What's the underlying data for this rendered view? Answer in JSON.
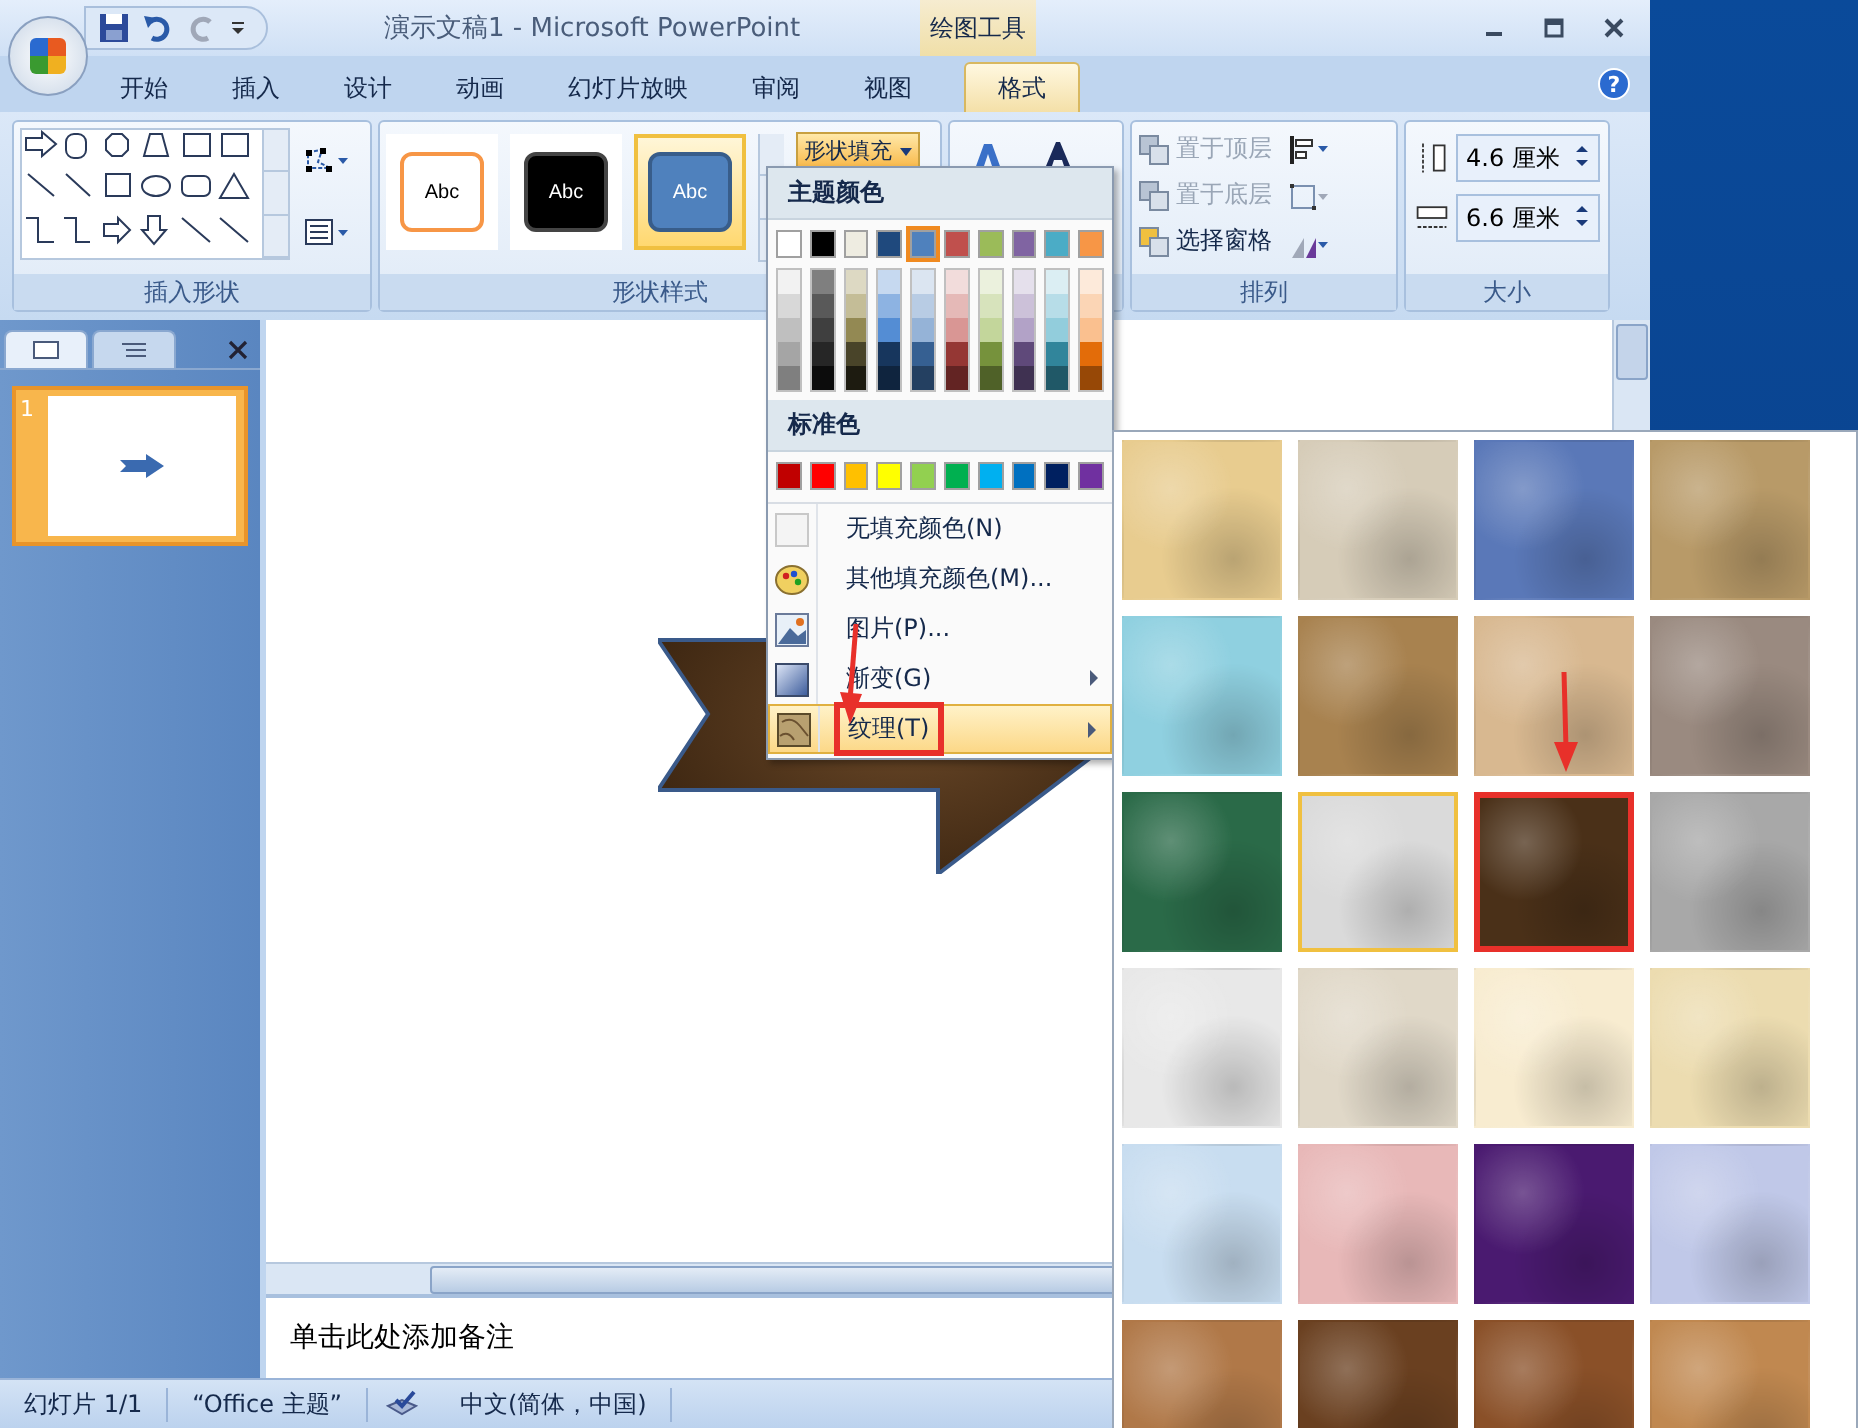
{
  "window": {
    "title": "演示文稿1 - Microsoft PowerPoint",
    "context_group": "绘图工具",
    "help_label": "?"
  },
  "tabs": [
    {
      "label": "开始",
      "selected": false
    },
    {
      "label": "插入",
      "selected": false
    },
    {
      "label": "设计",
      "selected": false
    },
    {
      "label": "动画",
      "selected": false
    },
    {
      "label": "幻灯片放映",
      "selected": false
    },
    {
      "label": "审阅",
      "selected": false
    },
    {
      "label": "视图",
      "selected": false
    },
    {
      "label": "格式",
      "selected": true
    }
  ],
  "insert_shapes": {
    "label": "插入形状"
  },
  "shape_styles": {
    "label": "形状样式",
    "styles": [
      {
        "text": "Abc",
        "kind": "outline",
        "selected": false
      },
      {
        "text": "Abc",
        "kind": "dark",
        "selected": false
      },
      {
        "text": "Abc",
        "kind": "filled",
        "selected": true
      }
    ],
    "fill_button": {
      "label": "形状填充",
      "pressed": true
    }
  },
  "arrange": {
    "label": "排列",
    "items": [
      {
        "label": "置于顶层",
        "kind": "front",
        "disabled": true
      },
      {
        "label": "置于底层",
        "kind": "back",
        "disabled": true
      },
      {
        "label": "选择窗格",
        "kind": "pane",
        "disabled": false
      }
    ]
  },
  "size": {
    "label": "大小",
    "fields": [
      {
        "kind": "height",
        "value": "4.6 厘米"
      },
      {
        "kind": "width",
        "value": "6.6 厘米"
      }
    ]
  },
  "slides_panel": {
    "slides": [
      {
        "number": "1",
        "selected": true
      }
    ]
  },
  "notes": {
    "text": "单击此处添加备注"
  },
  "status_bar": {
    "slide": "幻灯片 1/1",
    "theme": "“Office 主题”",
    "language": "中文(简体，中国)"
  },
  "fill_menu": {
    "theme_heading": "主题颜色",
    "standard_heading": "标准色",
    "theme_colors": [
      {
        "color": "#ffffff",
        "selected": false,
        "shades": [
          {
            "color": "#f2f2f2"
          },
          {
            "color": "#d8d8d8"
          },
          {
            "color": "#bfbfbf"
          },
          {
            "color": "#a5a5a5"
          },
          {
            "color": "#7f7f7f"
          }
        ]
      },
      {
        "color": "#000000",
        "selected": false,
        "shades": [
          {
            "color": "#7f7f7f"
          },
          {
            "color": "#595959"
          },
          {
            "color": "#3f3f3f"
          },
          {
            "color": "#262626"
          },
          {
            "color": "#0c0c0c"
          }
        ]
      },
      {
        "color": "#eeece1",
        "selected": false,
        "shades": [
          {
            "color": "#ddd9c3"
          },
          {
            "color": "#c4bd97"
          },
          {
            "color": "#938953"
          },
          {
            "color": "#494429"
          },
          {
            "color": "#1d1b10"
          }
        ]
      },
      {
        "color": "#1f497d",
        "selected": false,
        "shades": [
          {
            "color": "#c6d9f0"
          },
          {
            "color": "#8db3e2"
          },
          {
            "color": "#548dd4"
          },
          {
            "color": "#17365d"
          },
          {
            "color": "#0f243e"
          }
        ]
      },
      {
        "color": "#4f81bd",
        "selected": true,
        "shades": [
          {
            "color": "#dbe5f1"
          },
          {
            "color": "#b8cce4"
          },
          {
            "color": "#95b3d7"
          },
          {
            "color": "#366092"
          },
          {
            "color": "#244061"
          }
        ]
      },
      {
        "color": "#c0504d",
        "selected": false,
        "shades": [
          {
            "color": "#f2dcdb"
          },
          {
            "color": "#e5b9b7"
          },
          {
            "color": "#d99694"
          },
          {
            "color": "#953734"
          },
          {
            "color": "#632423"
          }
        ]
      },
      {
        "color": "#9bbb59",
        "selected": false,
        "shades": [
          {
            "color": "#ebf1dd"
          },
          {
            "color": "#d7e3bc"
          },
          {
            "color": "#c3d69b"
          },
          {
            "color": "#76923c"
          },
          {
            "color": "#4f6128"
          }
        ]
      },
      {
        "color": "#8064a2",
        "selected": false,
        "shades": [
          {
            "color": "#e5e0ec"
          },
          {
            "color": "#ccc1d9"
          },
          {
            "color": "#b2a2c7"
          },
          {
            "color": "#5f497a"
          },
          {
            "color": "#3f3151"
          }
        ]
      },
      {
        "color": "#4bacc6",
        "selected": false,
        "shades": [
          {
            "color": "#dbeef3"
          },
          {
            "color": "#b7dde8"
          },
          {
            "color": "#92cddc"
          },
          {
            "color": "#31859b"
          },
          {
            "color": "#205867"
          }
        ]
      },
      {
        "color": "#f79646",
        "selected": false,
        "shades": [
          {
            "color": "#fdeada"
          },
          {
            "color": "#fbd5b5"
          },
          {
            "color": "#fac08f"
          },
          {
            "color": "#e36c09"
          },
          {
            "color": "#974806"
          }
        ]
      }
    ],
    "standard_colors": [
      {
        "color": "#c00000"
      },
      {
        "color": "#ff0000"
      },
      {
        "color": "#ffc000"
      },
      {
        "color": "#ffff00"
      },
      {
        "color": "#92d050"
      },
      {
        "color": "#00b050"
      },
      {
        "color": "#00b0f0"
      },
      {
        "color": "#0070c0"
      },
      {
        "color": "#002060"
      },
      {
        "color": "#7030a0"
      }
    ],
    "items": [
      {
        "label": "无填充颜色(N)",
        "kind": "none",
        "submenu": false,
        "highlighted": false,
        "marked": false
      },
      {
        "label": "其他填充颜色(M)...",
        "kind": "palette",
        "submenu": false,
        "highlighted": false,
        "marked": false
      },
      {
        "label": "图片(P)...",
        "kind": "picture",
        "submenu": false,
        "highlighted": false,
        "marked": false
      },
      {
        "label": "渐变(G)",
        "kind": "gradient",
        "submenu": true,
        "highlighted": false,
        "marked": false
      },
      {
        "label": "纹理(T)",
        "kind": "texture",
        "submenu": true,
        "highlighted": true,
        "marked": true
      }
    ]
  },
  "texture_gallery": {
    "textures": [
      {
        "color": "#e8cc8f",
        "selected": false,
        "hovered": false
      },
      {
        "color": "#d6ccb8",
        "selected": false,
        "hovered": false
      },
      {
        "color": "#5a78b8",
        "selected": false,
        "hovered": false
      },
      {
        "color": "#b89a68",
        "selected": false,
        "hovered": false
      },
      {
        "color": "#8fd0e0",
        "selected": false,
        "hovered": false
      },
      {
        "color": "#a8824f",
        "selected": false,
        "hovered": false
      },
      {
        "color": "#d8b890",
        "selected": false,
        "hovered": false
      },
      {
        "color": "#9a8a80",
        "selected": false,
        "hovered": false
      },
      {
        "color": "#2a6a48",
        "selected": false,
        "hovered": false
      },
      {
        "color": "#dadada",
        "selected": false,
        "hovered": true
      },
      {
        "color": "#4a3018",
        "selected": true,
        "hovered": false
      },
      {
        "color": "#a8a8a8",
        "selected": false,
        "hovered": false
      },
      {
        "color": "#e8e8e8",
        "selected": false,
        "hovered": false
      },
      {
        "color": "#e0d8c8",
        "selected": false,
        "hovered": false
      },
      {
        "color": "#f8ecd0",
        "selected": false,
        "hovered": false
      },
      {
        "color": "#ecdcb0",
        "selected": false,
        "hovered": false
      },
      {
        "color": "#c8ddf0",
        "selected": false,
        "hovered": false
      },
      {
        "color": "#e8b8b8",
        "selected": false,
        "hovered": false
      },
      {
        "color": "#4a1a70",
        "selected": false,
        "hovered": false
      },
      {
        "color": "#c0c8e8",
        "selected": false,
        "hovered": false
      },
      {
        "color": "#b07848",
        "selected": false,
        "hovered": false
      },
      {
        "color": "#6a4020",
        "selected": false,
        "hovered": false
      },
      {
        "color": "#8a5028",
        "selected": false,
        "hovered": false
      },
      {
        "color": "#c08850",
        "selected": false,
        "hovered": false
      }
    ]
  }
}
